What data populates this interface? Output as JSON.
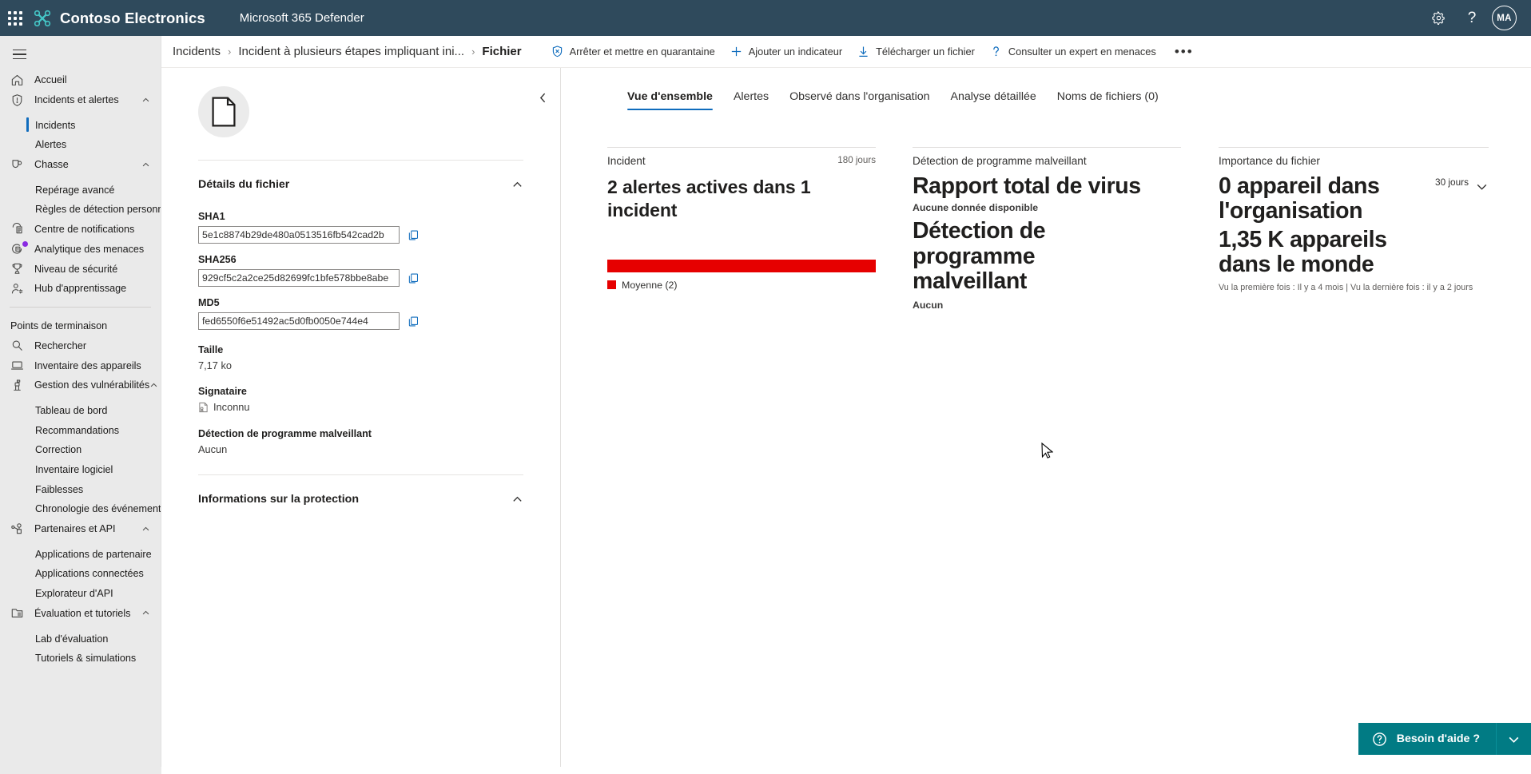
{
  "topbar": {
    "waffle_label": "app-launcher",
    "brand": "Contoso Electronics",
    "app": "Microsoft 365 Defender",
    "settings_icon": "gear-icon",
    "help_icon": "question-mark-icon",
    "help_glyph": "?",
    "avatar_initials": "MA",
    "bg_color": "#2f4a5c",
    "logo_color": "#45c8c8"
  },
  "sidebar": {
    "hamburger_label": "Menu",
    "items": [
      {
        "label": "Accueil",
        "icon": "home-icon",
        "type": "item",
        "name": "accueil"
      },
      {
        "label": "Incidents et alertes",
        "icon": "shield-alert-icon",
        "type": "item",
        "expandable": true,
        "name": "incidents-et-alertes"
      },
      {
        "label": "Incidents",
        "icon": "",
        "type": "sub",
        "selected": true,
        "name": "incidents"
      },
      {
        "label": "Alertes",
        "icon": "",
        "type": "sub",
        "name": "alertes"
      },
      {
        "label": "Chasse",
        "icon": "hunting-icon",
        "type": "item",
        "expandable": true,
        "name": "chasse"
      },
      {
        "label": "Repérage avancé",
        "icon": "",
        "type": "sub",
        "name": "reperage-avance"
      },
      {
        "label": "Règles de détection personna...",
        "icon": "",
        "type": "sub",
        "name": "regles-de-detection-personnalisees"
      },
      {
        "label": "Centre de notifications",
        "icon": "notifications-icon",
        "type": "item",
        "name": "centre-de-notifications"
      },
      {
        "label": "Analytique des menaces",
        "icon": "threat-analytics-icon",
        "type": "item",
        "badge": true,
        "name": "analytique-des-menaces"
      },
      {
        "label": "Niveau de sécurité",
        "icon": "trophy-icon",
        "type": "item",
        "name": "niveau-de-securite"
      },
      {
        "label": "Hub d'apprentissage",
        "icon": "learning-icon",
        "type": "item",
        "name": "hub-d-apprentissage"
      }
    ],
    "section_title": "Points de terminaison",
    "endpoint_items": [
      {
        "label": "Rechercher",
        "icon": "search-icon",
        "type": "item",
        "name": "rechercher"
      },
      {
        "label": "Inventaire des appareils",
        "icon": "device-icon",
        "type": "item",
        "name": "inventaire-des-appareils"
      },
      {
        "label": "Gestion des vulnérabilités",
        "icon": "vulnerability-icon",
        "type": "item",
        "expandable": true,
        "name": "gestion-des-vulnerabilites"
      },
      {
        "label": "Tableau de bord",
        "icon": "",
        "type": "sub",
        "name": "tableau-de-bord"
      },
      {
        "label": "Recommandations",
        "icon": "",
        "type": "sub",
        "name": "recommandations"
      },
      {
        "label": "Correction",
        "icon": "",
        "type": "sub",
        "name": "correction"
      },
      {
        "label": "Inventaire logiciel",
        "icon": "",
        "type": "sub",
        "name": "inventaire-logiciel"
      },
      {
        "label": "Faiblesses",
        "icon": "",
        "type": "sub",
        "name": "faiblesses"
      },
      {
        "label": "Chronologie des événements",
        "icon": "",
        "type": "sub",
        "name": "chronologie-des-evenements"
      },
      {
        "label": "Partenaires et API",
        "icon": "partners-api-icon",
        "type": "item",
        "expandable": true,
        "name": "partenaires-et-api"
      },
      {
        "label": "Applications de partenaire",
        "icon": "",
        "type": "sub",
        "name": "applications-de-partenaire"
      },
      {
        "label": "Applications connectées",
        "icon": "",
        "type": "sub",
        "name": "applications-connectees"
      },
      {
        "label": "Explorateur d'API",
        "icon": "",
        "type": "sub",
        "name": "explorateur-d-api"
      },
      {
        "label": "Évaluation et tutoriels",
        "icon": "evaluation-icon",
        "type": "item",
        "expandable": true,
        "name": "evaluation-et-tutoriels"
      },
      {
        "label": "Lab d'évaluation",
        "icon": "",
        "type": "sub",
        "name": "lab-d-evaluation"
      },
      {
        "label": "Tutoriels & simulations",
        "icon": "",
        "type": "sub",
        "name": "tutoriels-et-simulations"
      }
    ]
  },
  "breadcrumb": {
    "root": "Incidents",
    "parent": "Incident à plusieurs étapes impliquant ini...",
    "current": "Fichier",
    "separator": "›"
  },
  "commands": [
    {
      "label": "Arrêter et mettre en quarantaine",
      "icon": "stop-quarantine-icon",
      "name": "stop-and-quarantine-button"
    },
    {
      "label": "Ajouter un indicateur",
      "icon": "plus-icon",
      "name": "add-indicator-button"
    },
    {
      "label": "Télécharger un fichier",
      "icon": "download-icon",
      "name": "download-file-button"
    },
    {
      "label": "Consulter un expert en menaces",
      "icon": "question-mark-icon",
      "name": "consult-threat-expert-button"
    }
  ],
  "commands_more": "•••",
  "details": {
    "file_icon": "document-icon",
    "sections": [
      {
        "title": "Détails du fichier",
        "expanded": true,
        "name": "file-details-section"
      },
      {
        "title": "Informations sur la protection",
        "expanded": true,
        "name": "protection-info-section"
      }
    ],
    "sha1_label": "SHA1",
    "sha1_value": "5e1c8874b29de480a0513516fb542cad2b",
    "sha256_label": "SHA256",
    "sha256_value": "929cf5c2a2ce25d82699fc1bfe578bbe8abe",
    "md5_label": "MD5",
    "md5_value": "fed6550f6e51492ac5d0fb0050e744e4",
    "size_label": "Taille",
    "size_value": "7,17 ko",
    "signer_label": "Signataire",
    "signer_value": "Inconnu",
    "malware_label": "Détection de programme malveillant",
    "malware_value": "Aucun",
    "copy_tooltip": "Copier"
  },
  "tabs": [
    {
      "label": "Vue d'ensemble",
      "active": true,
      "name": "tab-vue-densemble"
    },
    {
      "label": "Alertes",
      "active": false,
      "name": "tab-alertes"
    },
    {
      "label": "Observé dans l'organisation",
      "active": false,
      "name": "tab-observe-dans-lorganisation"
    },
    {
      "label": "Analyse détaillée",
      "active": false,
      "name": "tab-analyse-detaillee"
    },
    {
      "label": "Noms de fichiers (0)",
      "active": false,
      "name": "tab-noms-de-fichiers"
    }
  ],
  "cards": {
    "incident": {
      "label": "Incident",
      "period": "180 jours",
      "headline": "2 alertes actives dans 1 incident",
      "bar_color": "#e60000",
      "legend_label": "Moyenne (2)",
      "legend_color": "#e60000"
    },
    "malware": {
      "label": "Détection de programme malveillant",
      "title_1": "Rapport total de virus",
      "sub_1": "Aucune donnée disponible",
      "title_2": "Détection de programme malveillant",
      "sub_2": "Aucun"
    },
    "prevalence": {
      "label": "Importance du fichier",
      "period": "30 jours",
      "org_value": "0 appareil dans l'organisation",
      "world_value": "1,35 K appareils dans le monde",
      "footer": "Vu la première fois : Il y a 4 mois | Vu la dernière fois : il y a 2 jours"
    }
  },
  "help": {
    "label": "Besoin d'aide ?",
    "icon": "question-circle-icon",
    "chevron_icon": "chevron-down-icon",
    "bg_color": "#017b84"
  }
}
